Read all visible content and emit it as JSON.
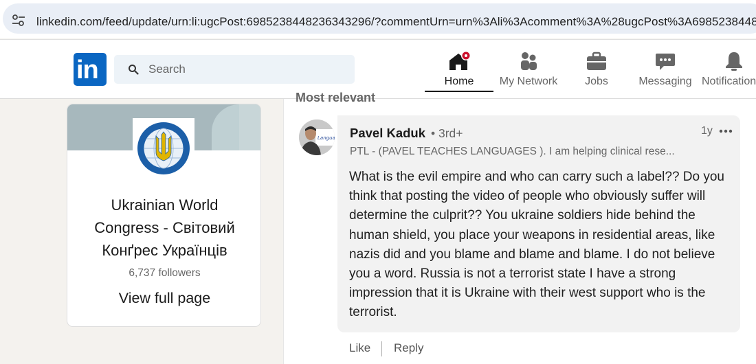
{
  "browser": {
    "url": "linkedin.com/feed/update/urn:li:ugcPost:6985238448236343296/?commentUrn=urn%3Ali%3Acomment%3A%28ugcPost%3A6985238448"
  },
  "nav": {
    "search_placeholder": "Search",
    "items": [
      {
        "label": "Home"
      },
      {
        "label": "My Network"
      },
      {
        "label": "Jobs"
      },
      {
        "label": "Messaging"
      },
      {
        "label": "Notifications"
      }
    ],
    "brand_color": "#0a66c2",
    "notification_dot_color": "#cb112d"
  },
  "org_card": {
    "name": "Ukrainian World Congress - Світовий Конґрес Українців",
    "followers": "6,737 followers",
    "view_full": "View full page"
  },
  "comments": {
    "sort_label": "Most relevant",
    "items": [
      {
        "author": "Pavel Kaduk",
        "degree": "• 3rd+",
        "headline": "PTL - (PAVEL TEACHES LANGUAGES ). I am helping clinical rese...",
        "time": "1y",
        "text": "What is the evil empire and who can carry such a label?? Do you think that posting the video of people who obviously suffer will determine the culprit?? You ukraine soldiers hide behind the human shield, you place your weapons in residential areas, like nazis did and you blame and blame and blame. I do not believe you a word. Russia is not a terrorist state I have a strong impression that it is Ukraine with their west support who is the terrorist.",
        "like_label": "Like",
        "reply_label": "Reply"
      }
    ]
  }
}
